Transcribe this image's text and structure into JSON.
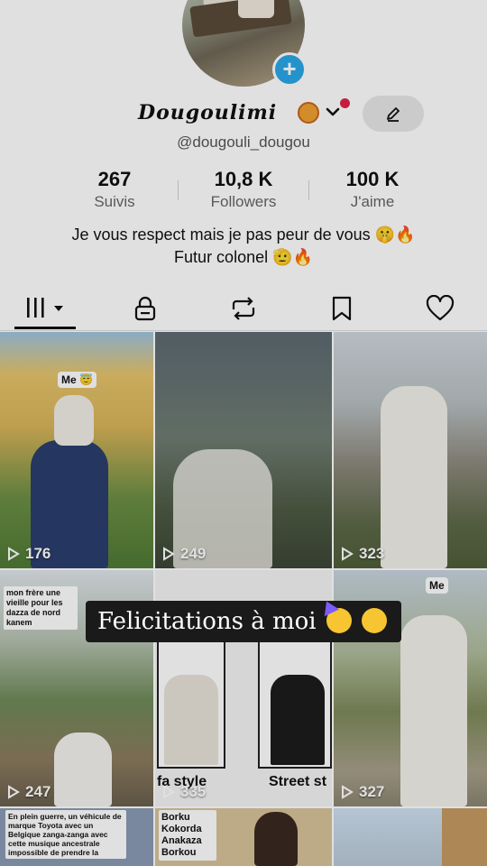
{
  "profile": {
    "display_name": "Dougoulimi",
    "name_emoji_icon": "lion-face-icon",
    "username": "@dougouli_dougou",
    "add_icon": "plus-icon",
    "edit_icon": "pencil-icon"
  },
  "stats": [
    {
      "value": "267",
      "label": "Suivis"
    },
    {
      "value": "10,8 K",
      "label": "Followers"
    },
    {
      "value": "100 K",
      "label": "J'aime"
    }
  ],
  "bio": {
    "line1": "Je vous respect mais je pas peur de vous 🤫🔥",
    "line2": "Futur colonel 🫡🔥"
  },
  "tabs": [
    {
      "name": "videos",
      "icon": "grid-bars-icon",
      "active": true
    },
    {
      "name": "private",
      "icon": "lock-icon"
    },
    {
      "name": "reposts",
      "icon": "repost-icon"
    },
    {
      "name": "favorites",
      "icon": "bookmark-icon"
    },
    {
      "name": "liked",
      "icon": "heart-icon"
    }
  ],
  "videos": [
    {
      "views": "176",
      "tag": "Me 😇"
    },
    {
      "views": "249"
    },
    {
      "views": "323"
    },
    {
      "views": "247",
      "caption": "mon frère une vieille pour les dazza de nord kanem"
    },
    {
      "views": "335",
      "label_left": "fa style",
      "label_right": "Street st"
    },
    {
      "views": "327",
      "tag": "Me"
    },
    {
      "caption": "En plein guerre, un véhicule de marque Toyota avec un Belgique zanga-zanga avec cette musique ancestrale impossible de prendre la"
    },
    {
      "caption": "Borku Kokorda Anakaza Borkou"
    },
    {}
  ],
  "overlay": {
    "banner_text": "Felicitations à moi",
    "banner_emoji": [
      "partying-face",
      "hugging-face"
    ]
  },
  "colors": {
    "accent": "#2aa8e8",
    "notification_dot": "#e0224a",
    "banner_bg": "#1a1a1a"
  }
}
